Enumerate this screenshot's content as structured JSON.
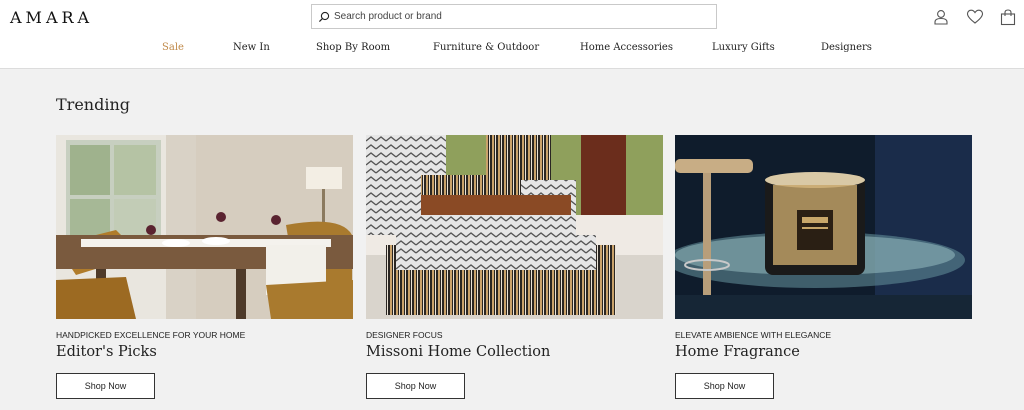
{
  "brand": {
    "logo_text": "AMARA"
  },
  "search": {
    "placeholder": "Search product or brand",
    "value": ""
  },
  "header_icons": [
    "user-icon",
    "heart-icon",
    "bag-icon"
  ],
  "nav": {
    "items": [
      {
        "label": "Sale",
        "highlight": true
      },
      {
        "label": "New In"
      },
      {
        "label": "Shop By Room"
      },
      {
        "label": "Furniture & Outdoor"
      },
      {
        "label": "Home Accessories"
      },
      {
        "label": "Luxury Gifts"
      },
      {
        "label": "Designers"
      }
    ]
  },
  "colors": {
    "accent": "#c08a4a",
    "page_bg": "#f1f1f1",
    "text": "#222222"
  },
  "trending": {
    "title": "Trending",
    "cards": [
      {
        "eyebrow": "HANDPICKED EXCELLENCE FOR YOUR HOME",
        "title": "Editor's Picks",
        "button": "Shop Now"
      },
      {
        "eyebrow": "DESIGNER FOCUS",
        "title": "Missoni Home Collection",
        "button": "Shop Now"
      },
      {
        "eyebrow": "ELEVATE AMBIENCE WITH ELEGANCE",
        "title": "Home Fragrance",
        "button": "Shop Now"
      }
    ]
  }
}
